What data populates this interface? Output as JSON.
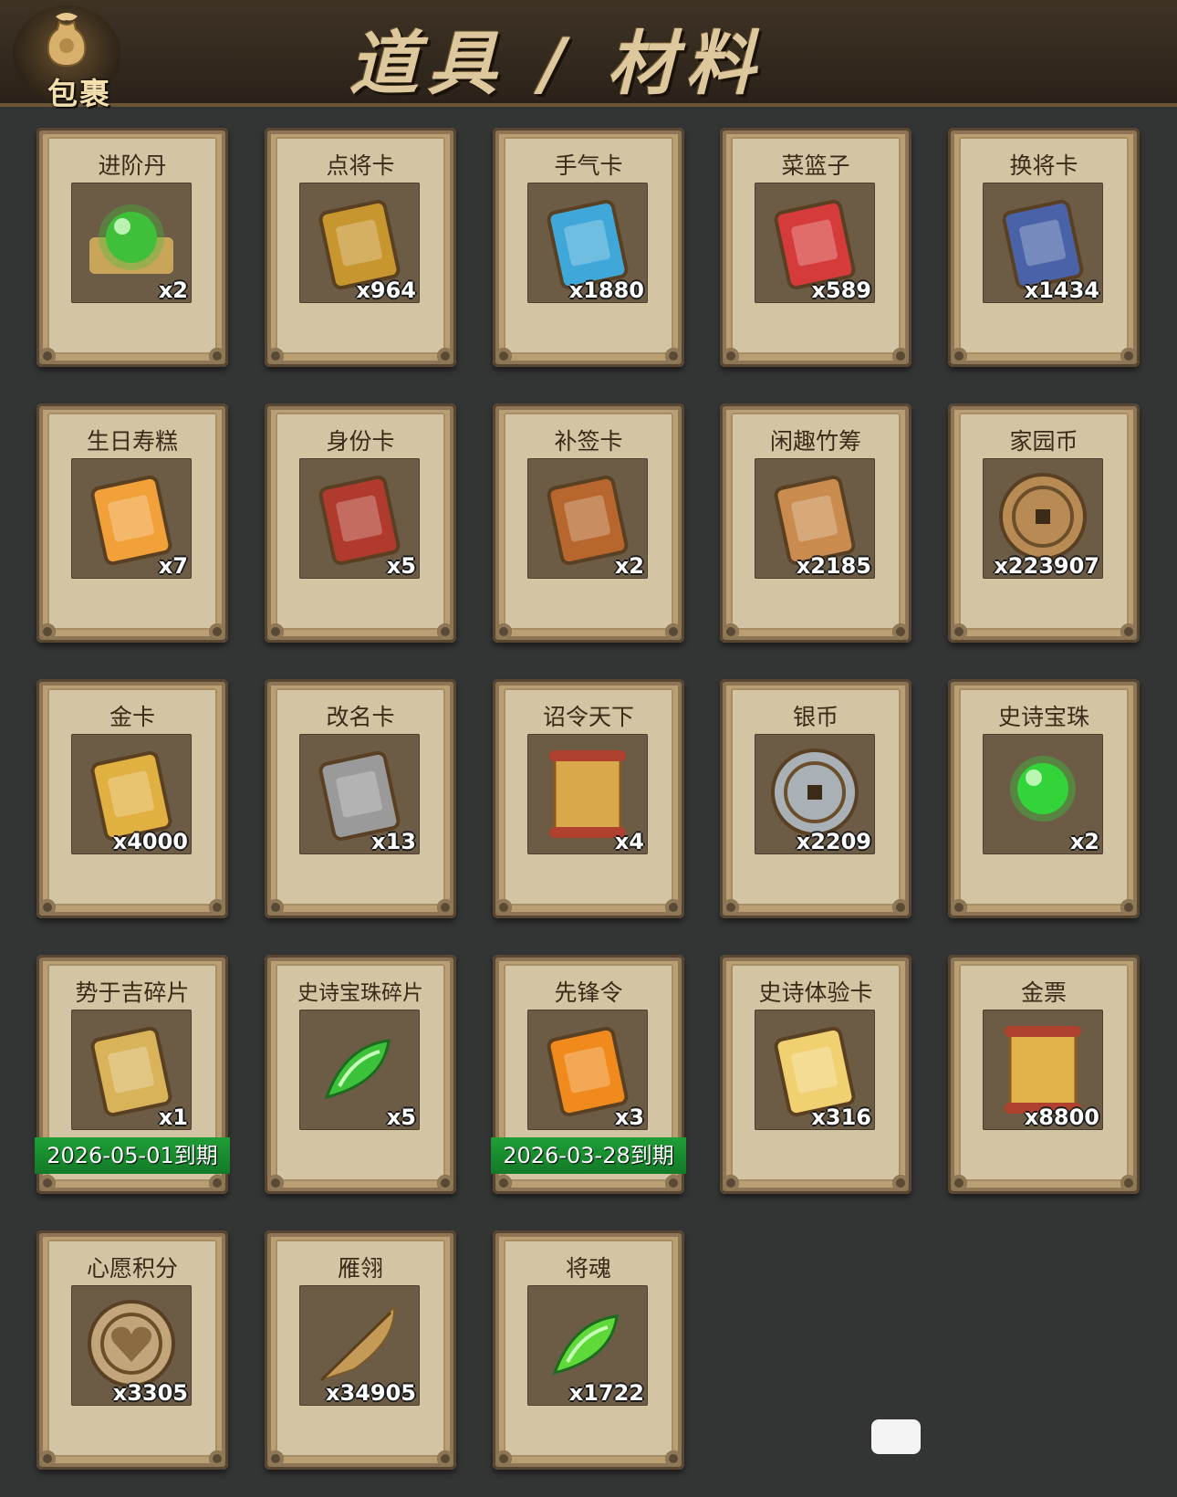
{
  "header": {
    "bag_label": "包裹",
    "title": "道具 / 材料"
  },
  "items": [
    {
      "name": "进阶丹",
      "count": "x2",
      "icon": "green-orb-on-gold-cloth",
      "color": "#3fbf3a"
    },
    {
      "name": "点将卡",
      "count": "x964",
      "icon": "gold-token-red-tassel",
      "color": "#c8962e"
    },
    {
      "name": "手气卡",
      "count": "x1880",
      "icon": "gold-card-blue-arrows",
      "color": "#3fa8d8"
    },
    {
      "name": "菜篮子",
      "count": "x589",
      "icon": "flower-basket",
      "color": "#d63b3b"
    },
    {
      "name": "换将卡",
      "count": "x1434",
      "icon": "jade-token-blue-tassel",
      "color": "#4a63a8"
    },
    {
      "name": "生日寿糕",
      "count": "x7",
      "icon": "orange-cake",
      "color": "#f2a13a"
    },
    {
      "name": "身份卡",
      "count": "x5",
      "icon": "opera-mask-card",
      "color": "#b03a2e"
    },
    {
      "name": "补签卡",
      "count": "x2",
      "icon": "bronze-tag-orange-ribbon",
      "color": "#b7672e"
    },
    {
      "name": "闲趣竹筹",
      "count": "x2185",
      "icon": "bamboo-tallies",
      "color": "#c98b4e"
    },
    {
      "name": "家园币",
      "count": "x223907",
      "icon": "bronze-coin",
      "color": "#b88b55"
    },
    {
      "name": "金卡",
      "count": "x4000",
      "icon": "gold-cards",
      "color": "#e0b040"
    },
    {
      "name": "改名卡",
      "count": "x13",
      "icon": "name-plaque",
      "color": "#9a9a9a"
    },
    {
      "name": "诏令天下",
      "count": "x4",
      "icon": "imperial-scroll",
      "color": "#d9a84a"
    },
    {
      "name": "银币",
      "count": "x2209",
      "icon": "silver-coins",
      "color": "#a9b1b6"
    },
    {
      "name": "史诗宝珠",
      "count": "x2",
      "icon": "green-glow-orb",
      "color": "#33d33a"
    },
    {
      "name": "势于吉碎片",
      "count": "x1",
      "icon": "portrait-puzzle-piece",
      "color": "#d9b35a",
      "expiry": "2026-05-01到期"
    },
    {
      "name": "史诗宝珠碎片",
      "count": "x5",
      "icon": "green-shard",
      "color": "#3cc23a"
    },
    {
      "name": "先锋令",
      "count": "x3",
      "icon": "fire-stone",
      "color": "#f08a1c",
      "expiry": "2026-03-28到期"
    },
    {
      "name": "史诗体验卡",
      "count": "x316",
      "icon": "gold-blank-card",
      "color": "#f0d070"
    },
    {
      "name": "金票",
      "count": "x8800",
      "icon": "gold-note-scroll",
      "color": "#e2b34b"
    },
    {
      "name": "心愿积分",
      "count": "x3305",
      "icon": "heart-coin",
      "color": "#c2a57a"
    },
    {
      "name": "雁翎",
      "count": "x34905",
      "icon": "feather",
      "color": "#c49a56"
    },
    {
      "name": "将魂",
      "count": "x1722",
      "icon": "green-crystal",
      "color": "#5fd83a"
    }
  ]
}
